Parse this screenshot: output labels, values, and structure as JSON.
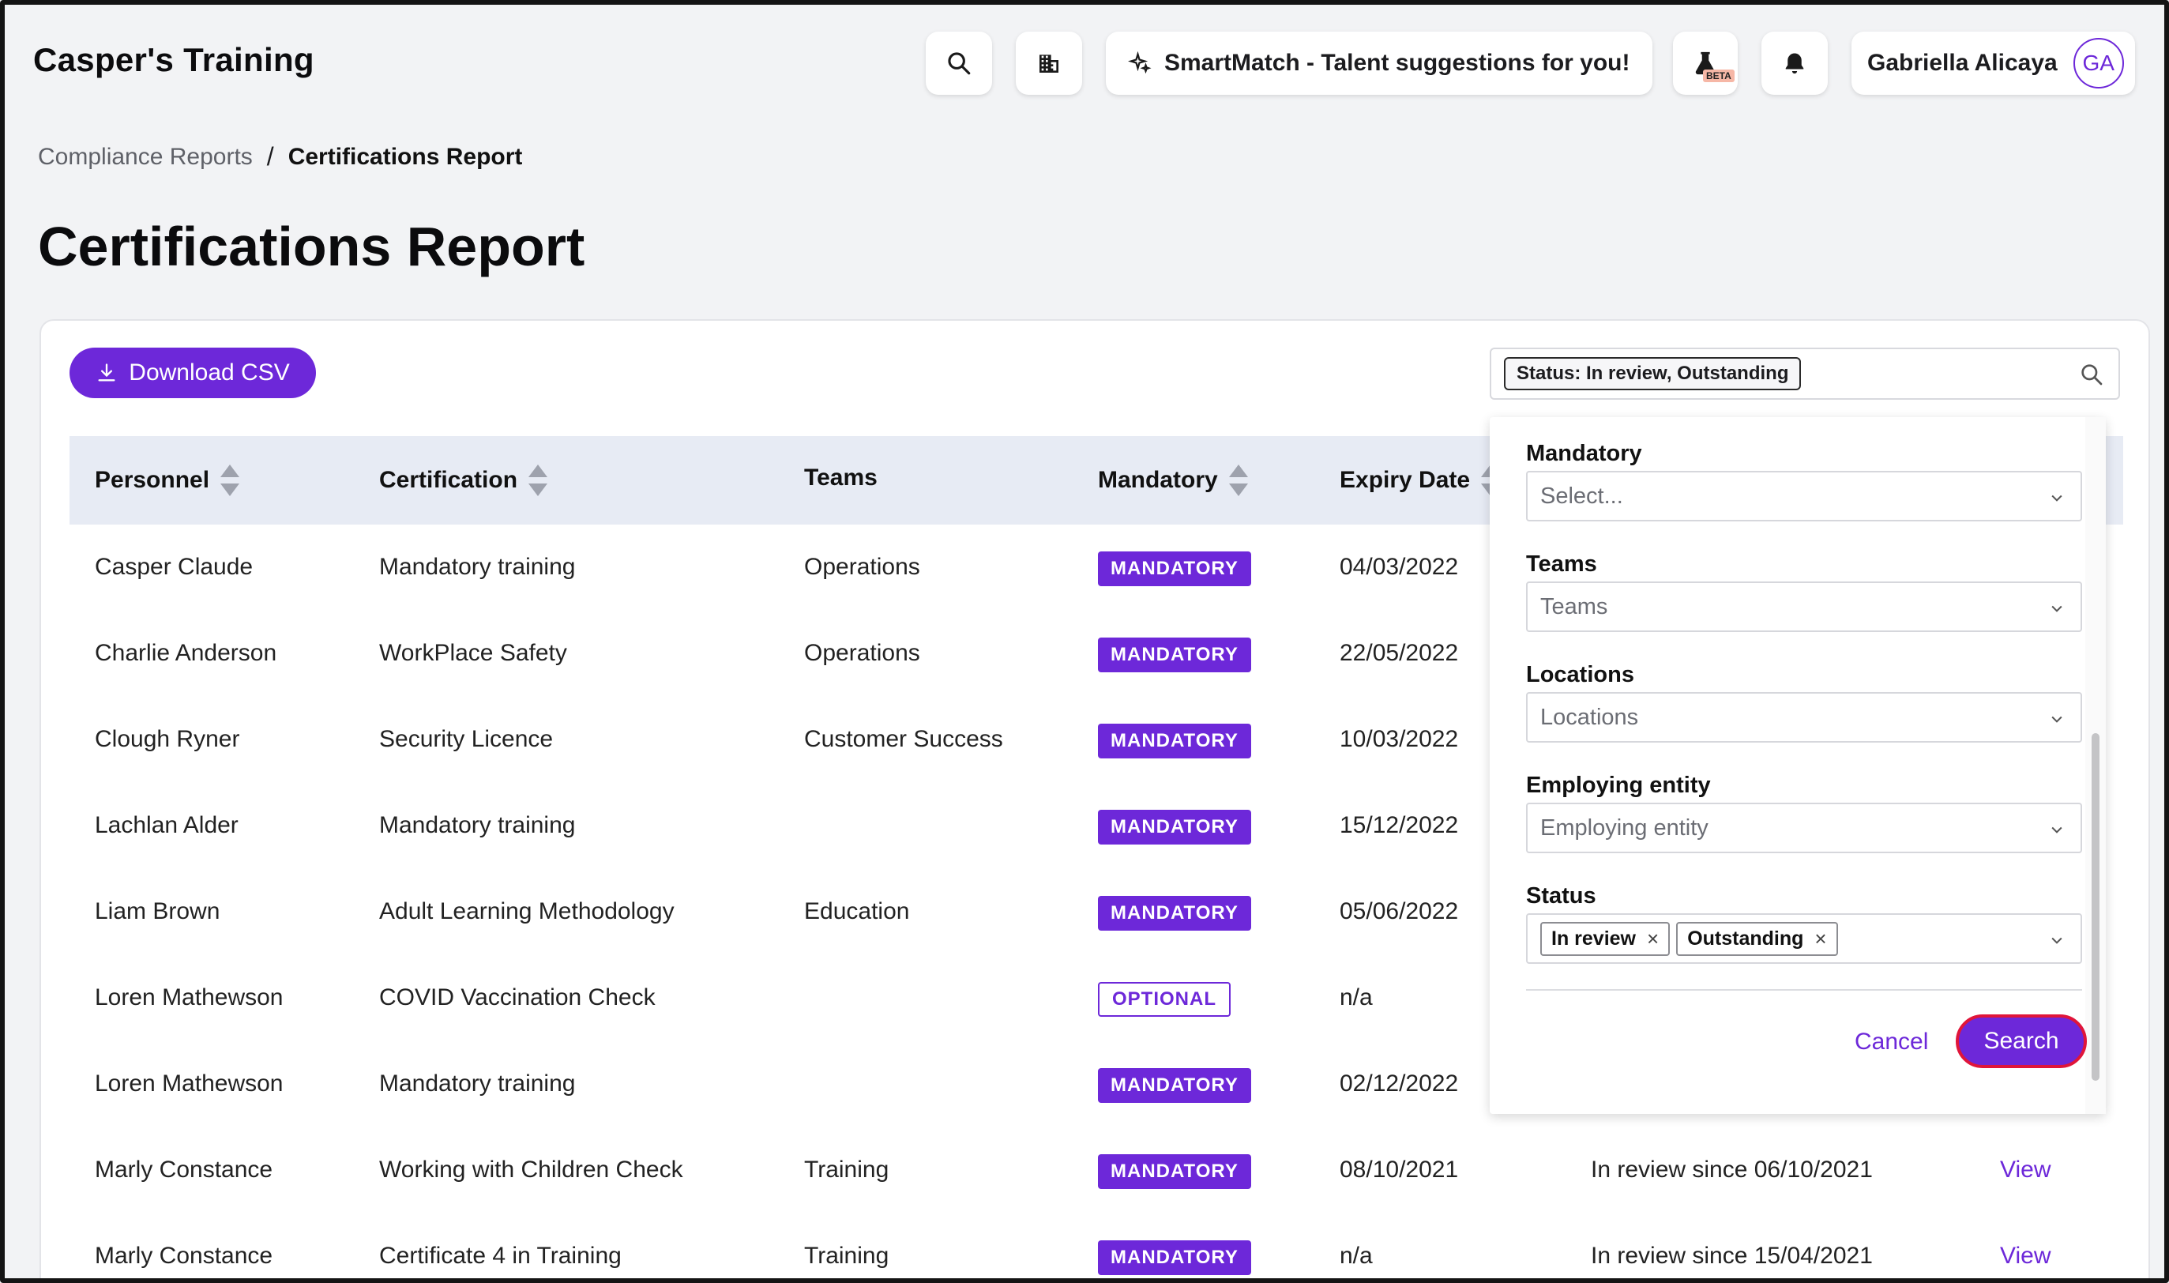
{
  "app": {
    "title": "Casper's Training"
  },
  "header": {
    "smartmatch_label": "SmartMatch - Talent suggestions for you!",
    "beta_label": "BETA",
    "user_name": "Gabriella Alicaya",
    "user_initials": "GA"
  },
  "breadcrumb": {
    "parent": "Compliance Reports",
    "separator": "/",
    "current": "Certifications Report"
  },
  "page": {
    "title": "Certifications Report"
  },
  "toolbar": {
    "download_label": "Download CSV",
    "filter_chip": "Status: In review, Outstanding"
  },
  "table": {
    "columns": {
      "personnel": "Personnel",
      "certification": "Certification",
      "teams": "Teams",
      "mandatory": "Mandatory",
      "expiry": "Expiry Date"
    },
    "rows": [
      {
        "personnel": "Casper Claude",
        "certification": "Mandatory training",
        "teams": "Operations",
        "mandatory": "MANDATORY",
        "expiry": "04/03/2022",
        "status": "",
        "action": ""
      },
      {
        "personnel": "Charlie Anderson",
        "certification": "WorkPlace Safety",
        "teams": "Operations",
        "mandatory": "MANDATORY",
        "expiry": "22/05/2022",
        "status": "",
        "action": ""
      },
      {
        "personnel": "Clough Ryner",
        "certification": "Security Licence",
        "teams": "Customer Success",
        "mandatory": "MANDATORY",
        "expiry": "10/03/2022",
        "status": "",
        "action": ""
      },
      {
        "personnel": "Lachlan Alder",
        "certification": "Mandatory training",
        "teams": "",
        "mandatory": "MANDATORY",
        "expiry": "15/12/2022",
        "status": "",
        "action": ""
      },
      {
        "personnel": "Liam Brown",
        "certification": "Adult Learning Methodology",
        "teams": "Education",
        "mandatory": "MANDATORY",
        "expiry": "05/06/2022",
        "status": "",
        "action": ""
      },
      {
        "personnel": "Loren Mathewson",
        "certification": "COVID Vaccination Check",
        "teams": "",
        "mandatory": "OPTIONAL",
        "expiry": "n/a",
        "status": "",
        "action": ""
      },
      {
        "personnel": "Loren Mathewson",
        "certification": "Mandatory training",
        "teams": "",
        "mandatory": "MANDATORY",
        "expiry": "02/12/2022",
        "status": "",
        "action": ""
      },
      {
        "personnel": "Marly Constance",
        "certification": "Working with Children Check",
        "teams": "Training",
        "mandatory": "MANDATORY",
        "expiry": "08/10/2021",
        "status": "In review since 06/10/2021",
        "action": "View"
      },
      {
        "personnel": "Marly Constance",
        "certification": "Certificate 4 in Training",
        "teams": "Training",
        "mandatory": "MANDATORY",
        "expiry": "n/a",
        "status": "In review since 15/04/2021",
        "action": "View"
      }
    ]
  },
  "filter_panel": {
    "mandatory": {
      "label": "Mandatory",
      "placeholder": "Select..."
    },
    "teams": {
      "label": "Teams",
      "placeholder": "Teams"
    },
    "locations": {
      "label": "Locations",
      "placeholder": "Locations"
    },
    "employing_entity": {
      "label": "Employing entity",
      "placeholder": "Employing entity"
    },
    "status": {
      "label": "Status",
      "tags": [
        "In review",
        "Outstanding"
      ]
    },
    "cancel_label": "Cancel",
    "search_label": "Search"
  },
  "colors": {
    "accent": "#6d28d9",
    "focus_ring": "#e0153a",
    "header_row": "#e7ebf4"
  },
  "icons": [
    "search-icon",
    "building-icon",
    "sparkle-icon",
    "flask-icon",
    "bell-icon",
    "download-icon",
    "sort-icon",
    "chevron-down-icon",
    "close-icon"
  ]
}
